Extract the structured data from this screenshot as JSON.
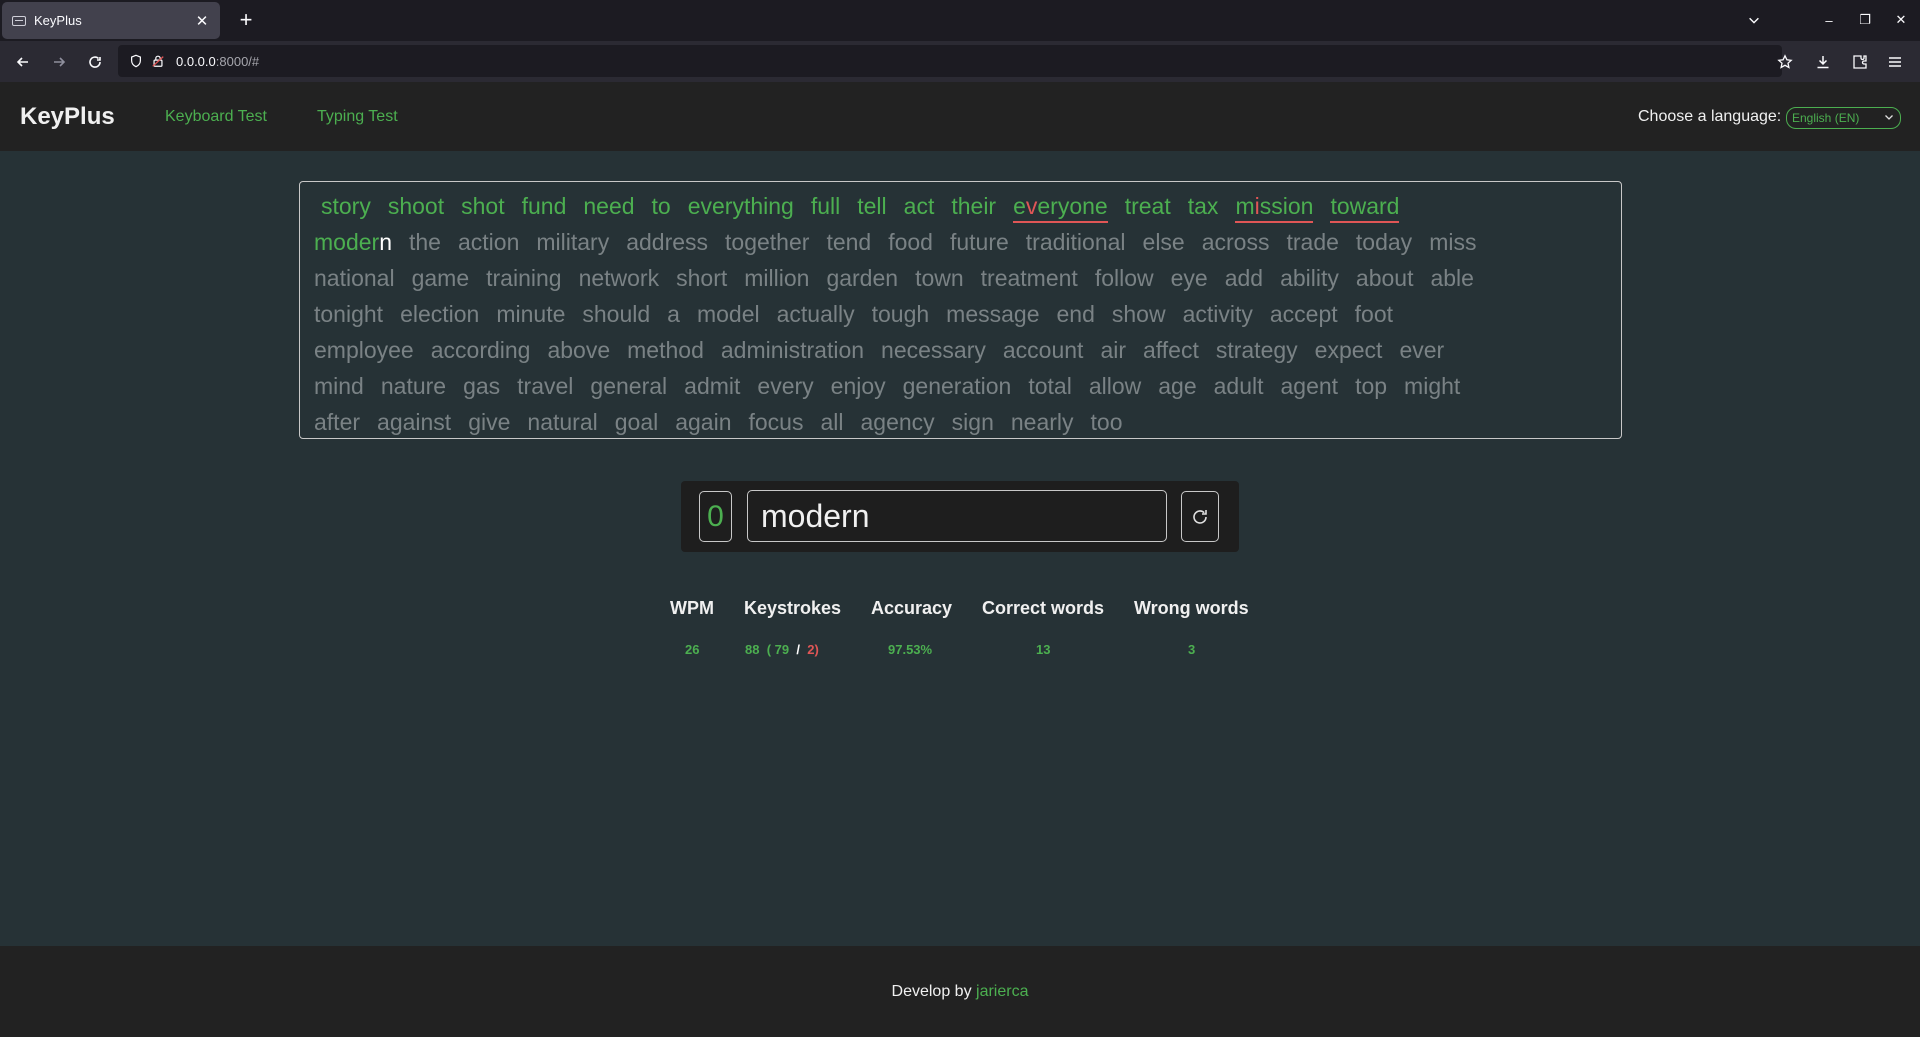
{
  "browser": {
    "tab_title": "KeyPlus",
    "url_host": "0.0.0.0",
    "url_rest": ":8000/#"
  },
  "header": {
    "brand": "KeyPlus",
    "nav": [
      "Keyboard Test",
      "Typing Test"
    ],
    "language_label": "Choose a language:",
    "language_selected": "English (EN)"
  },
  "words": {
    "lines": [
      [
        {
          "text": "story",
          "state": "correct"
        },
        {
          "text": "shoot",
          "state": "correct"
        },
        {
          "text": "shot",
          "state": "correct"
        },
        {
          "text": "fund",
          "state": "correct"
        },
        {
          "text": "need",
          "state": "correct"
        },
        {
          "text": "to",
          "state": "correct"
        },
        {
          "text": "everything",
          "state": "correct"
        },
        {
          "text": "full",
          "state": "correct"
        },
        {
          "text": "tell",
          "state": "correct"
        },
        {
          "text": "act",
          "state": "correct"
        },
        {
          "text": "their",
          "state": "correct"
        },
        {
          "text": "everyone",
          "state": "wrong",
          "parts": [
            {
              "t": "e",
              "bad": false
            },
            {
              "t": "v",
              "bad": true
            },
            {
              "t": "eryone",
              "bad": false
            }
          ]
        },
        {
          "text": "treat",
          "state": "correct"
        },
        {
          "text": "tax",
          "state": "correct"
        },
        {
          "text": "mission",
          "state": "wrong",
          "parts": [
            {
              "t": "m",
              "bad": false
            },
            {
              "t": "i",
              "bad": true
            },
            {
              "t": "ssion",
              "bad": false
            }
          ]
        },
        {
          "text": "toward",
          "state": "wrong",
          "parts": [
            {
              "t": "toward",
              "bad": false
            }
          ]
        }
      ],
      [
        {
          "text": "modern",
          "state": "current",
          "typed": "moder",
          "next": "n"
        },
        {
          "text": "the",
          "state": "pending"
        },
        {
          "text": "action",
          "state": "pending"
        },
        {
          "text": "military",
          "state": "pending"
        },
        {
          "text": "address",
          "state": "pending"
        },
        {
          "text": "together",
          "state": "pending"
        },
        {
          "text": "tend",
          "state": "pending"
        },
        {
          "text": "food",
          "state": "pending"
        },
        {
          "text": "future",
          "state": "pending"
        },
        {
          "text": "traditional",
          "state": "pending"
        },
        {
          "text": "else",
          "state": "pending"
        },
        {
          "text": "across",
          "state": "pending"
        },
        {
          "text": "trade",
          "state": "pending"
        },
        {
          "text": "today",
          "state": "pending"
        },
        {
          "text": "miss",
          "state": "pending"
        }
      ],
      [
        {
          "text": "national",
          "state": "pending"
        },
        {
          "text": "game",
          "state": "pending"
        },
        {
          "text": "training",
          "state": "pending"
        },
        {
          "text": "network",
          "state": "pending"
        },
        {
          "text": "short",
          "state": "pending"
        },
        {
          "text": "million",
          "state": "pending"
        },
        {
          "text": "garden",
          "state": "pending"
        },
        {
          "text": "town",
          "state": "pending"
        },
        {
          "text": "treatment",
          "state": "pending"
        },
        {
          "text": "follow",
          "state": "pending"
        },
        {
          "text": "eye",
          "state": "pending"
        },
        {
          "text": "add",
          "state": "pending"
        },
        {
          "text": "ability",
          "state": "pending"
        },
        {
          "text": "about",
          "state": "pending"
        },
        {
          "text": "able",
          "state": "pending"
        }
      ],
      [
        {
          "text": "tonight",
          "state": "pending"
        },
        {
          "text": "election",
          "state": "pending"
        },
        {
          "text": "minute",
          "state": "pending"
        },
        {
          "text": "should",
          "state": "pending"
        },
        {
          "text": "a",
          "state": "pending"
        },
        {
          "text": "model",
          "state": "pending"
        },
        {
          "text": "actually",
          "state": "pending"
        },
        {
          "text": "tough",
          "state": "pending"
        },
        {
          "text": "message",
          "state": "pending"
        },
        {
          "text": "end",
          "state": "pending"
        },
        {
          "text": "show",
          "state": "pending"
        },
        {
          "text": "activity",
          "state": "pending"
        },
        {
          "text": "accept",
          "state": "pending"
        },
        {
          "text": "foot",
          "state": "pending"
        }
      ],
      [
        {
          "text": "employee",
          "state": "pending"
        },
        {
          "text": "according",
          "state": "pending"
        },
        {
          "text": "above",
          "state": "pending"
        },
        {
          "text": "method",
          "state": "pending"
        },
        {
          "text": "administration",
          "state": "pending"
        },
        {
          "text": "necessary",
          "state": "pending"
        },
        {
          "text": "account",
          "state": "pending"
        },
        {
          "text": "air",
          "state": "pending"
        },
        {
          "text": "affect",
          "state": "pending"
        },
        {
          "text": "strategy",
          "state": "pending"
        },
        {
          "text": "expect",
          "state": "pending"
        },
        {
          "text": "ever",
          "state": "pending"
        }
      ],
      [
        {
          "text": "mind",
          "state": "pending"
        },
        {
          "text": "nature",
          "state": "pending"
        },
        {
          "text": "gas",
          "state": "pending"
        },
        {
          "text": "travel",
          "state": "pending"
        },
        {
          "text": "general",
          "state": "pending"
        },
        {
          "text": "admit",
          "state": "pending"
        },
        {
          "text": "every",
          "state": "pending"
        },
        {
          "text": "enjoy",
          "state": "pending"
        },
        {
          "text": "generation",
          "state": "pending"
        },
        {
          "text": "total",
          "state": "pending"
        },
        {
          "text": "allow",
          "state": "pending"
        },
        {
          "text": "age",
          "state": "pending"
        },
        {
          "text": "adult",
          "state": "pending"
        },
        {
          "text": "agent",
          "state": "pending"
        },
        {
          "text": "top",
          "state": "pending"
        },
        {
          "text": "might",
          "state": "pending"
        }
      ],
      [
        {
          "text": "after",
          "state": "pending"
        },
        {
          "text": "against",
          "state": "pending"
        },
        {
          "text": "give",
          "state": "pending"
        },
        {
          "text": "natural",
          "state": "pending"
        },
        {
          "text": "goal",
          "state": "pending"
        },
        {
          "text": "again",
          "state": "pending"
        },
        {
          "text": "focus",
          "state": "pending"
        },
        {
          "text": "all",
          "state": "pending"
        },
        {
          "text": "agency",
          "state": "pending"
        },
        {
          "text": "sign",
          "state": "pending"
        },
        {
          "text": "nearly",
          "state": "pending"
        },
        {
          "text": "too",
          "state": "pending"
        }
      ]
    ]
  },
  "input": {
    "timer": "0",
    "value": "modern"
  },
  "stats": {
    "headers": {
      "wpm": "WPM",
      "keystrokes": "Keystrokes",
      "accuracy": "Accuracy",
      "correct": "Correct words",
      "wrong": "Wrong words"
    },
    "wpm": "26",
    "keystrokes_total": "88",
    "keystrokes_open": "(",
    "keystrokes_correct": "79",
    "keystrokes_sep": "/",
    "keystrokes_wrong": "2",
    "keystrokes_close": ")",
    "accuracy": "97.53%",
    "correct_words": "13",
    "wrong_words": "3"
  },
  "footer": {
    "prefix": "Develop by",
    "author": "jarierca"
  },
  "colors": {
    "accent": "#4caf50",
    "error": "#e05656",
    "background": "#263236"
  }
}
